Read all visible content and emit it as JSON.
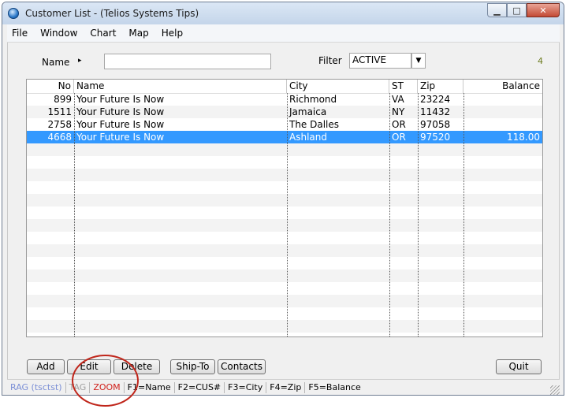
{
  "window": {
    "title": "Customer List - (Telios Systems Tips)",
    "minimize_glyph": "▁",
    "maximize_glyph": "□",
    "close_glyph": "✕",
    "icon": "globe-app-icon"
  },
  "menu": {
    "items": [
      {
        "label": "File"
      },
      {
        "label": "Window"
      },
      {
        "label": "Chart"
      },
      {
        "label": "Map"
      },
      {
        "label": "Help"
      }
    ]
  },
  "search": {
    "name_label": "Name",
    "name_arrow": "▸",
    "name_value": "",
    "filter_label": "Filter",
    "filter_value": "ACTIVE",
    "filter_arrow": "▼",
    "record_count": "4"
  },
  "grid": {
    "columns": [
      "No",
      "Name",
      "City",
      "ST",
      "Zip",
      "Balance"
    ],
    "rows": [
      {
        "no": "899",
        "name": "Your Future Is Now",
        "city": "Richmond",
        "st": "VA",
        "zip": "23224",
        "balance": ""
      },
      {
        "no": "1511",
        "name": "Your Future Is Now",
        "city": "Jamaica",
        "st": "NY",
        "zip": "11432",
        "balance": ""
      },
      {
        "no": "2758",
        "name": "Your Future Is Now",
        "city": "The Dalles",
        "st": "OR",
        "zip": "97058",
        "balance": ""
      },
      {
        "no": "4668",
        "name": "Your Future Is Now",
        "city": "Ashland",
        "st": "OR",
        "zip": "97520",
        "balance": "118.00"
      }
    ],
    "selected_row": 3
  },
  "buttons": {
    "add": "Add",
    "edit": "Edit",
    "delete": "Delete",
    "ship_to": "Ship-To",
    "contacts": "Contacts",
    "quit": "Quit"
  },
  "status": {
    "segments": [
      {
        "label": "RAG (tsctst)",
        "color": "#7b8fd6"
      },
      {
        "label": "TAG",
        "color": "#a0a0a0"
      },
      {
        "label": "ZOOM",
        "color": "#d0201a"
      },
      {
        "label": "F1=Name",
        "color": "#000000"
      },
      {
        "label": "F2=CUS#",
        "color": "#000000"
      },
      {
        "label": "F3=City",
        "color": "#000000"
      },
      {
        "label": "F4=Zip",
        "color": "#000000"
      },
      {
        "label": "F5=Balance",
        "color": "#000000"
      }
    ]
  },
  "colors": {
    "selection": "#3399ff",
    "annotation_circle": "#c0261b"
  }
}
